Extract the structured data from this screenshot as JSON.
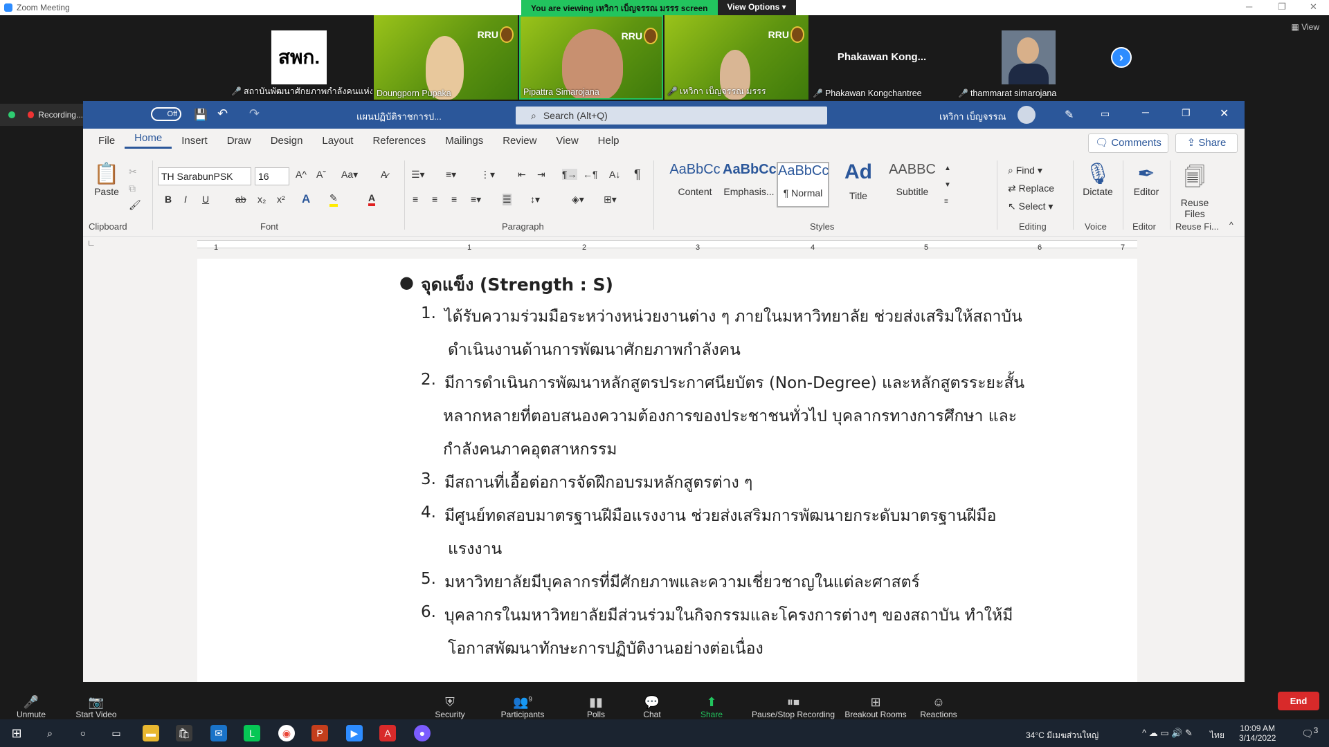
{
  "zoom": {
    "window_title": "Zoom Meeting",
    "viewing_banner": "You are viewing เหวิกา เบ็ญจรรณ มรรร screen",
    "view_options": "View Options",
    "view_button": "View",
    "participants": [
      {
        "name": "สถาบันพัฒนาศักยภาพกำลังคนแห่ง...",
        "tile_text": "สพก.",
        "muted": true
      },
      {
        "name": "Doungporn Pupaka",
        "tile_text": "RRU",
        "muted": false
      },
      {
        "name": "Pipattra Simarojana",
        "tile_text": "RRU",
        "muted": false
      },
      {
        "name": "เหวิกา เบ็ญจรรณ มรรร",
        "tile_text": "RRU",
        "muted": true
      },
      {
        "name": "Phakawan Kongchantree",
        "tile_text": "Phakawan  Kong...",
        "muted": true
      },
      {
        "name": "thammarat simarojana",
        "tile_text": "",
        "muted": true
      }
    ],
    "recording": {
      "label": "Recording...",
      "toggle": "Off"
    },
    "toolbar": {
      "unmute": "Unmute",
      "start_video": "Start Video",
      "security": "Security",
      "participants": "Participants",
      "participants_count": "9",
      "polls": "Polls",
      "chat": "Chat",
      "share_screen": "Share Screen",
      "pause_recording": "Pause/Stop Recording",
      "breakout_rooms": "Breakout Rooms",
      "reactions": "Reactions",
      "end": "End"
    }
  },
  "word": {
    "doc_title": "แผนปฏิบัติราชการป...",
    "search_placeholder": "Search (Alt+Q)",
    "user_name": "เหวิกา เบ็ญจรรณ",
    "tabs": [
      "File",
      "Home",
      "Insert",
      "Draw",
      "Design",
      "Layout",
      "References",
      "Mailings",
      "Review",
      "View",
      "Help"
    ],
    "comments": "Comments",
    "share": "Share",
    "ribbon": {
      "paste": "Paste",
      "clipboard": "Clipboard",
      "font_name": "TH SarabunPSK",
      "font_size": "16",
      "font": "Font",
      "paragraph": "Paragraph",
      "styles_label": "Styles",
      "styles": [
        {
          "sample": "AaBbCc",
          "name": "Content"
        },
        {
          "sample": "AaBbCc",
          "name": "Emphasis..."
        },
        {
          "sample": "AaBbCc",
          "name": "¶ Normal"
        },
        {
          "sample": "Ad",
          "name": "Title"
        },
        {
          "sample": "AABBC",
          "name": "Subtitle"
        }
      ],
      "find": "Find",
      "replace": "Replace",
      "select": "Select",
      "editing": "Editing",
      "dictate": "Dictate",
      "voice": "Voice",
      "editor": "Editor",
      "editor_group": "Editor",
      "reuse_files": "Reuse Files",
      "reuse_group": "Reuse Fi..."
    },
    "ruler_numbers": [
      "1",
      "1",
      "2",
      "3",
      "4",
      "5",
      "6",
      "7"
    ],
    "document": {
      "heading": "จุดแข็ง (Strength : S)",
      "items": [
        {
          "num": "1.",
          "lines": [
            "ได้รับความร่วมมือระหว่างหน่วยงานต่าง ๆ ภายในมหาวิทยาลัย ช่วยส่งเสริมให้สถาบัน",
            "ดำเนินงานด้านการพัฒนาศักยภาพกำลังคน"
          ]
        },
        {
          "num": "2.",
          "lines": [
            "มีการดำเนินการพัฒนาหลักสูตรประกาศนียบัตร (Non-Degree) และหลักสูตรระยะสั้น",
            "หลากหลายที่ตอบสนองความต้องการของประชาชนทั่วไป บุคลากรทางการศึกษา และ",
            "กำลังคนภาคอุตสาหกรรม"
          ]
        },
        {
          "num": "3.",
          "lines": [
            "มีสถานที่เอื้อต่อการจัดฝึกอบรมหลักสูตรต่าง ๆ"
          ]
        },
        {
          "num": "4.",
          "lines": [
            "มีศูนย์ทดสอบมาตรฐานฝีมือแรงงาน  ช่วยส่งเสริมการพัฒนายกระดับมาตรฐานฝีมือ",
            "แรงงาน"
          ]
        },
        {
          "num": "5.",
          "lines": [
            "มหาวิทยาลัยมีบุคลากรที่มีศักยภาพและความเชี่ยวชาญในแต่ละศาสตร์"
          ]
        },
        {
          "num": "6.",
          "lines": [
            "บุคลากรในมหาวิทยาลัยมีส่วนร่วมในกิจกรรมและโครงการต่างๆ ของสถาบัน ทำให้มี",
            "โอกาสพัฒนาทักษะการปฏิบัติงานอย่างต่อเนื่อง"
          ]
        }
      ]
    }
  },
  "taskbar": {
    "weather": "34°C มีเมฆส่วนใหญ่",
    "language": "ไทย",
    "time": "10:09 AM",
    "date": "3/14/2022",
    "notifications": "3"
  },
  "colors": {
    "word_blue": "#2b579a",
    "zoom_blue": "#2d8cff",
    "end_red": "#d82a2a",
    "share_green": "#22c45e"
  }
}
